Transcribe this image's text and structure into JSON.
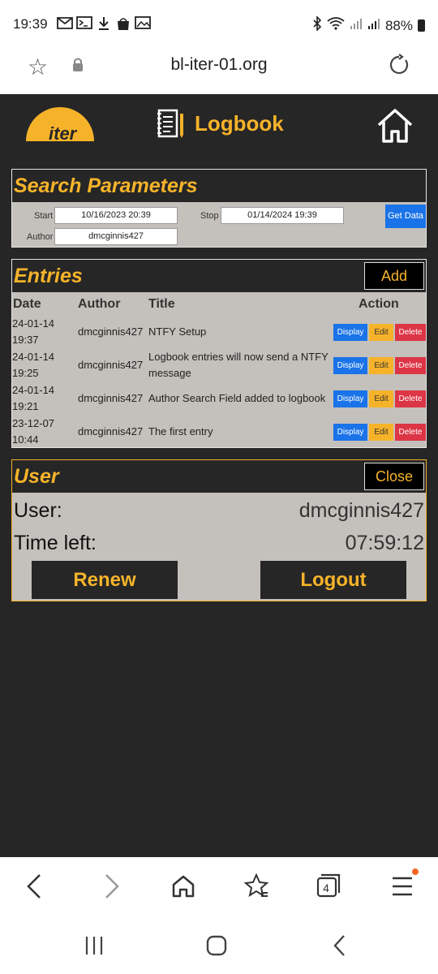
{
  "status": {
    "time": "19:39",
    "battery": "88%",
    "left_icons": [
      "gmail-icon",
      "terminal-icon",
      "download-icon",
      "shopping-bag-icon",
      "image-icon"
    ],
    "right_icons": [
      "bluetooth-icon",
      "wifi-icon",
      "signal-icon",
      "signal-icon"
    ]
  },
  "browser": {
    "url": "bl-iter-01.org",
    "tab_count": "4"
  },
  "header": {
    "logo_text": "iter",
    "title": "Logbook"
  },
  "search": {
    "title": "Search Parameters",
    "start_label": "Start",
    "start_value": "10/16/2023 20:39",
    "stop_label": "Stop",
    "stop_value": "01/14/2024 19:39",
    "author_label": "Author",
    "author_value": "dmcginnis427",
    "get_data_label": "Get Data"
  },
  "entries": {
    "title": "Entries",
    "add_label": "Add",
    "columns": [
      "Date",
      "Author",
      "Title",
      "Action"
    ],
    "display_label": "Display",
    "edit_label": "Edit",
    "delete_label": "Delete",
    "rows": [
      {
        "date": "24-01-14",
        "time": "19:37",
        "author": "dmcginnis427",
        "title": "NTFY Setup"
      },
      {
        "date": "24-01-14",
        "time": "19:25",
        "author": "dmcginnis427",
        "title": "Logbook entries will now send a NTFY message"
      },
      {
        "date": "24-01-14",
        "time": "19:21",
        "author": "dmcginnis427",
        "title": "Author Search Field added to logbook"
      },
      {
        "date": "23-12-07",
        "time": "10:44",
        "author": "dmcginnis427",
        "title": "The first entry"
      }
    ]
  },
  "user": {
    "title": "User",
    "close_label": "Close",
    "user_label": "User:",
    "user_value": "dmcginnis427",
    "time_left_label": "Time left:",
    "time_left_value": "07:59:12",
    "renew_label": "Renew",
    "logout_label": "Logout"
  },
  "colors": {
    "accent": "#f6b32a",
    "page_bg": "#262626",
    "panel_bg": "#c4c0bb",
    "display_btn": "#1a73e8",
    "delete_btn": "#dc3545"
  }
}
